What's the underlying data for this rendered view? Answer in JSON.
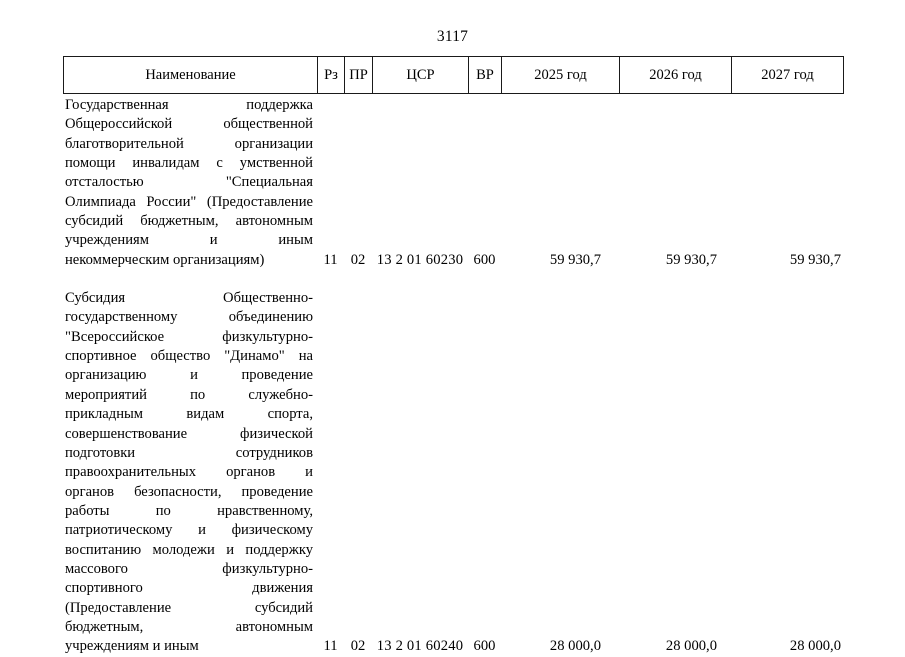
{
  "document": {
    "page_number": "3117"
  },
  "table": {
    "columns": [
      {
        "key": "name",
        "label": "Наименование"
      },
      {
        "key": "rz",
        "label": "Рз"
      },
      {
        "key": "pr",
        "label": "ПР"
      },
      {
        "key": "csr",
        "label": "ЦСР"
      },
      {
        "key": "vr",
        "label": "ВР"
      },
      {
        "key": "y2025",
        "label": "2025 год"
      },
      {
        "key": "y2026",
        "label": "2026 год"
      },
      {
        "key": "y2027",
        "label": "2027 год"
      }
    ],
    "rows": [
      {
        "name": "Государственная поддержка Общероссийской общественной благотворительной организации помощи инвалидам с умственной отсталостью \"Специальная Олимпиада России\" (Предоставление субсидий бюджетным, автономным учреждениям и иным некоммерческим организациям)",
        "name_lines": [
          "Государственная поддержка",
          "Общероссийской общественной",
          "благотворительной организации",
          "помощи инвалидам с умственной",
          "отсталостью \"Специальная",
          "Олимпиада России\" (Предоставление",
          "субсидий бюджетным, автономным",
          "учреждениям и иным",
          "некоммерческим организациям)"
        ],
        "rz": "11",
        "pr": "02",
        "csr": "13 2 01 60230",
        "vr": "600",
        "y2025": "59 930,7",
        "y2026": "59 930,7",
        "y2027": "59 930,7"
      },
      {
        "name": "Субсидия Общественно-государственному объединению \"Всероссийское физкультурно-спортивное общество \"Динамо\" на организацию и проведение мероприятий по служебно-прикладным видам спорта, совершенствование физической подготовки сотрудников правоохранительных органов и органов безопасности, проведение работы по нравственному, патриотическому и физическому воспитанию молодежи и поддержку массового физкультурно-спортивного движения (Предоставление субсидий бюджетным, автономным учреждениям и иным",
        "name_lines": [
          "Субсидия Общественно-",
          "государственному объединению",
          "\"Всероссийское физкультурно-",
          "спортивное общество \"Динамо\" на",
          "организацию и проведение",
          "мероприятий по служебно-",
          "прикладным видам спорта,",
          "совершенствование физической",
          "подготовки сотрудников",
          "правоохранительных органов и",
          "органов безопасности, проведение",
          "работы по нравственному,",
          "патриотическому и физическому",
          "воспитанию молодежи и поддержку",
          "массового физкультурно-",
          "спортивного движения",
          "(Предоставление субсидий",
          "бюджетным, автономным",
          "учреждениям и иным"
        ],
        "rz": "11",
        "pr": "02",
        "csr": "13 2 01 60240",
        "vr": "600",
        "y2025": "28 000,0",
        "y2026": "28 000,0",
        "y2027": "28 000,0"
      }
    ]
  }
}
